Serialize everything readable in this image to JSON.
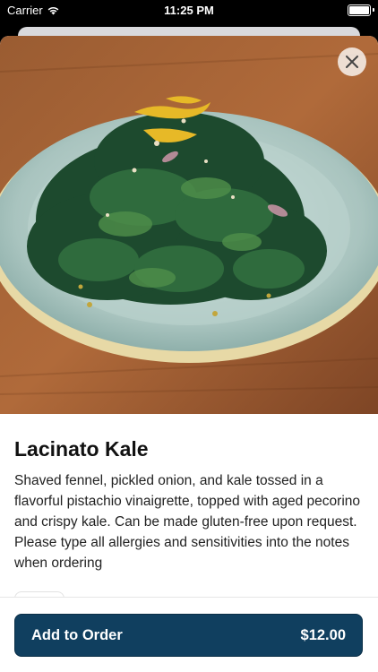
{
  "status_bar": {
    "carrier": "Carrier",
    "time": "11:25 PM"
  },
  "item": {
    "image_alt_icon": "salad-photo",
    "title": "Lacinato Kale",
    "description": "Shaved fennel, pickled onion, and kale tossed in a flavorful pistachio vinaigrette, topped with aged pecorino and crispy kale. Can be made gluten-free upon request. Please type all allergies and sensitivities into the notes when ordering"
  },
  "footer": {
    "add_label": "Add to Order",
    "price": "$12.00"
  },
  "colors": {
    "button": "#103f5f"
  }
}
